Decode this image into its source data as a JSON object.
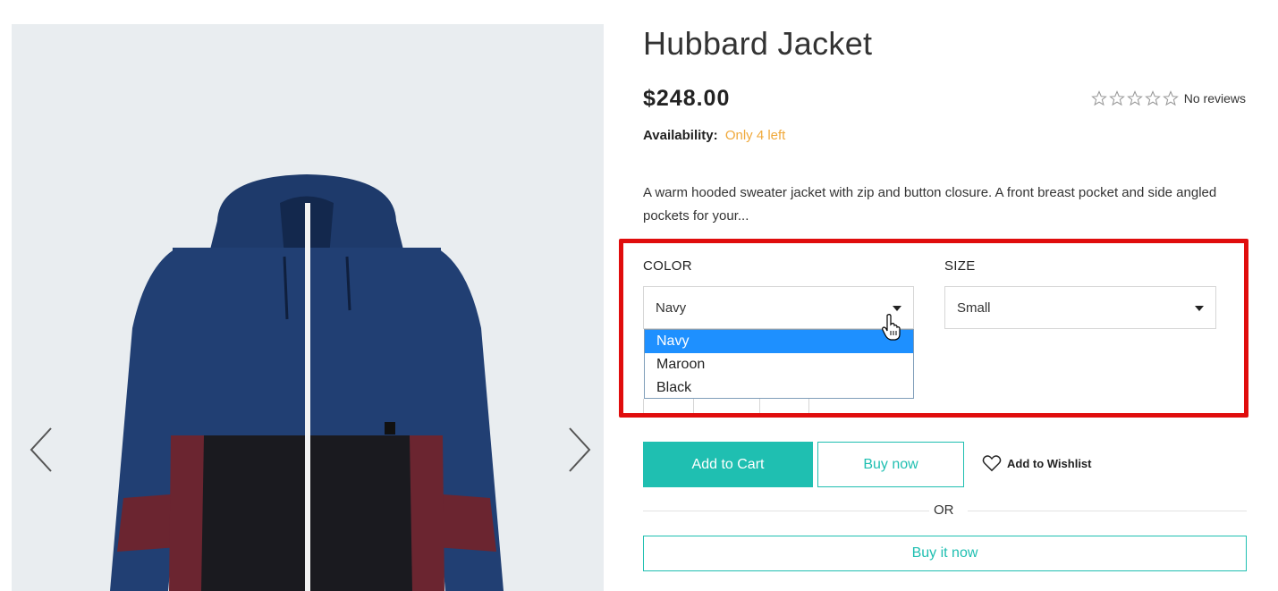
{
  "product": {
    "title": "Hubbard Jacket",
    "price": "$248.00",
    "reviews_text": "No reviews",
    "rating_stars": 0,
    "availability_label": "Availability:",
    "availability_value": "Only 4 left",
    "description": "A warm hooded sweater jacket with zip and button closure. A front breast pocket and side angled pockets for your..."
  },
  "options": {
    "color_label": "COLOR",
    "color_selected": "Navy",
    "color_options": [
      "Navy",
      "Maroon",
      "Black"
    ],
    "size_label": "SIZE",
    "size_selected": "Small"
  },
  "actions": {
    "add_to_cart": "Add to Cart",
    "buy_now": "Buy now",
    "add_to_wishlist": "Add to Wishlist",
    "or": "OR",
    "buy_it_now": "Buy it now"
  },
  "colors": {
    "accent": "#1fbfb1",
    "stock": "#f0a93b",
    "highlight": "#e00d0d",
    "option_selected": "#1e90ff"
  },
  "icons": {
    "prev": "chevron-left-icon",
    "next": "chevron-right-icon",
    "star": "star-outline-icon",
    "wishlist": "heart-outline-icon",
    "cursor": "hand-pointer-icon"
  }
}
